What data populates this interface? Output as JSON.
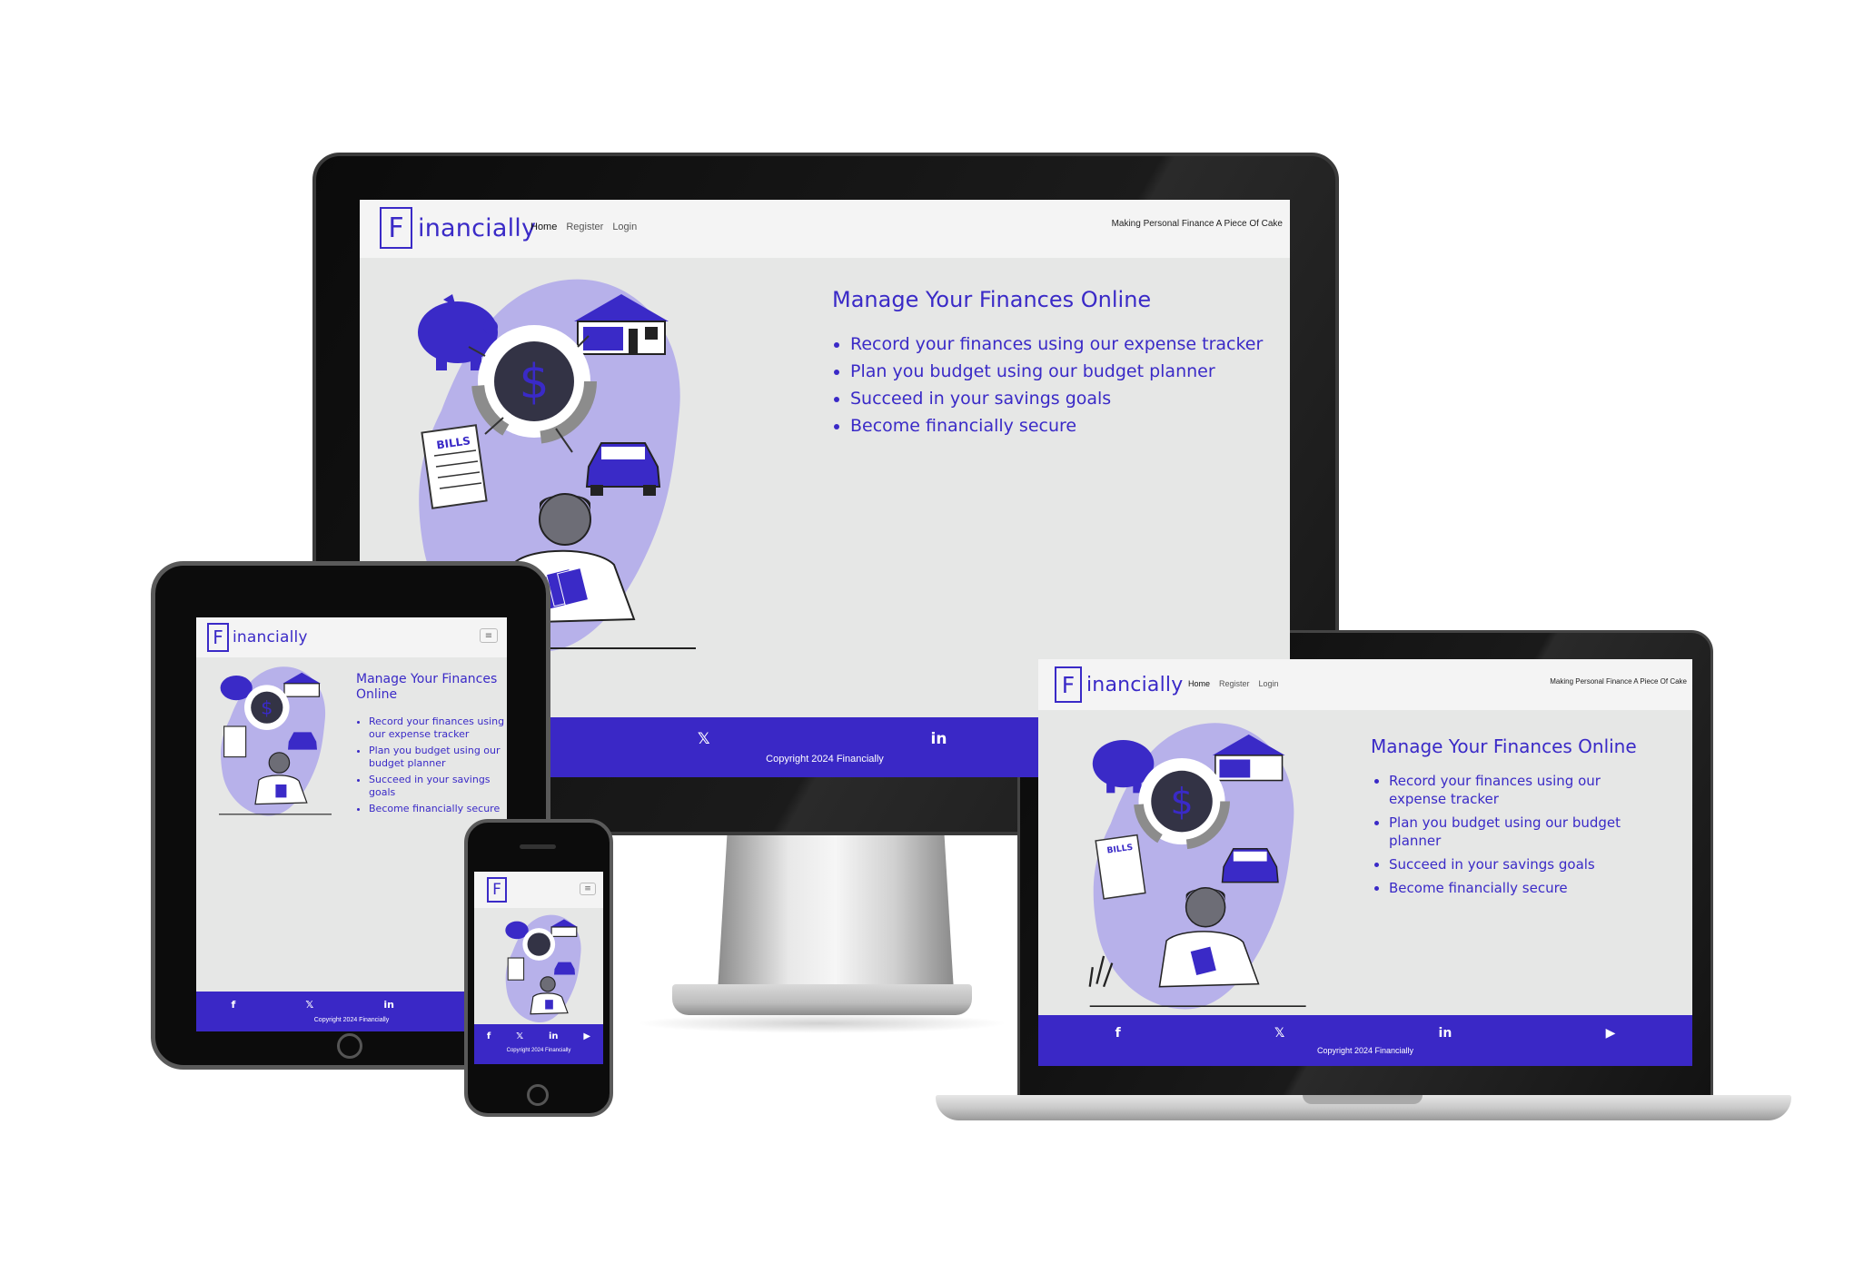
{
  "site": {
    "logo_letter": "F",
    "logo_text": "inancially",
    "nav": {
      "home": "Home",
      "register": "Register",
      "login": "Login"
    },
    "tagline": "Making Personal Finance A Piece Of Cake",
    "hero_title": "Manage Your Finances Online",
    "bullets": [
      "Record your finances using our expense tracker",
      "Plan you budget using our budget planner",
      "Succeed in your savings goals",
      "Become financially secure"
    ],
    "illustration_bills": "BILLS",
    "illustration_dollar": "$",
    "menu_icon": "hamburger-menu-icon",
    "footer_icons": [
      "facebook-icon",
      "x-twitter-icon",
      "linkedin-icon",
      "youtube-icon"
    ],
    "footer_glyphs": {
      "facebook": "f",
      "x": "𝕏",
      "linkedin": "in",
      "youtube": "▶"
    },
    "copyright": "Copyright 2024 Financially"
  },
  "colors": {
    "brand": "#3a2ac7",
    "footer": "#3a28c6",
    "page_bg": "#e6e7e6",
    "nav_bg": "#f4f4f4",
    "blob": "#b7b1ea"
  }
}
